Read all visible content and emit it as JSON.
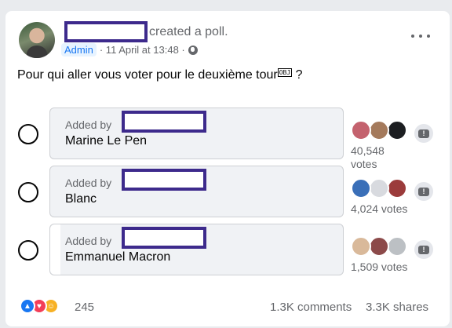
{
  "post": {
    "action_text": "created a poll.",
    "role_badge": "Admin",
    "timestamp": "· 11 April at 13:48 ·",
    "question_text": "Pour qui aller vous  voter pour le deuxième tour",
    "question_glyph": "OBJ",
    "question_suffix": " ?"
  },
  "poll": {
    "options": [
      {
        "added_by": "Added by",
        "label": "Marine Le Pen",
        "votes": "40,548 votes"
      },
      {
        "added_by": "Added by",
        "label": "Blanc",
        "votes": "4,024 votes"
      },
      {
        "added_by": "Added by",
        "label": "Emmanuel Macron",
        "votes": "1,509 votes"
      }
    ]
  },
  "footer": {
    "reaction_count": "245",
    "comments": "1.3K comments",
    "shares": "3.3K shares"
  },
  "colors": {
    "accent": "#1877f2",
    "redaction_border": "#3d2a8c"
  },
  "icons": [
    "globe-icon",
    "more-icon",
    "flag-icon",
    "like-icon",
    "love-icon",
    "haha-icon"
  ]
}
